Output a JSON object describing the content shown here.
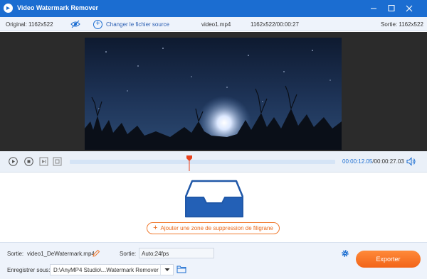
{
  "app": {
    "title": "Video Watermark Remover"
  },
  "info_bar": {
    "original_label": "Original: 1162x522",
    "change_source_label": "Changer le fichier source",
    "file_name": "video1.mp4",
    "file_info": "1162x522/00:00:27",
    "output_label": "Sortie: 1162x522"
  },
  "playback": {
    "current_time": "00:00:12.05",
    "total_time": "/00:00:27.03",
    "progress": 0.45
  },
  "workarea": {
    "add_zone_label": "Ajouter une zone de suppression de filigrane"
  },
  "bottom": {
    "output_label": "Sortie:",
    "output_file": "video1_DeWatermark.mp4",
    "format_label": "Sortie:",
    "format_value": "Auto;24fps",
    "save_label": "Enregistrer sous:",
    "save_path": "D:\\AnyMP4 Studio\\...Watermark Remover",
    "export_label": "Exporter"
  },
  "icons": {
    "logo": "app-logo-icon",
    "eye": "eye-slash-icon",
    "plus": "plus-circle-icon",
    "play": "play-icon",
    "stop": "stop-icon",
    "next_frame": "next-frame-icon",
    "loop": "loop-icon",
    "volume": "volume-icon",
    "tray": "inbox-tray-icon",
    "pencil": "pencil-icon",
    "gear": "gear-icon",
    "folder": "folder-icon"
  },
  "colors": {
    "titlebar": "#1b6dd1",
    "accent": "#1b6dd1",
    "export": "#f26418",
    "playhead": "#e8411c"
  }
}
